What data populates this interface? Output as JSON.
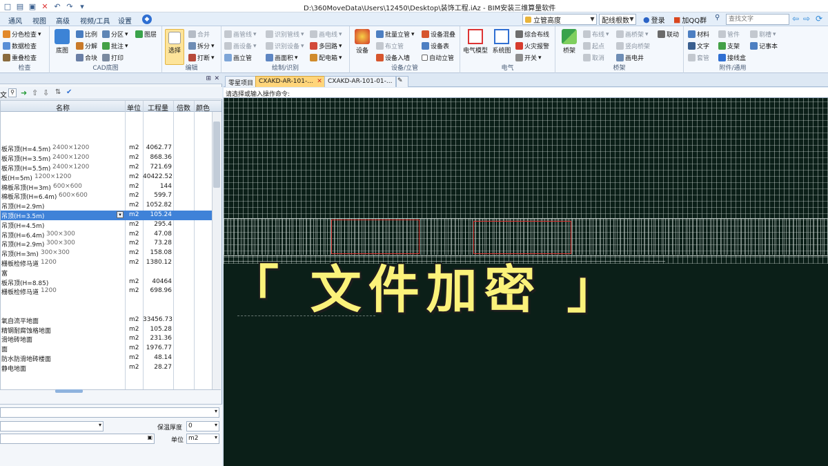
{
  "window": {
    "title": "D:\\360MoveData\\Users\\12450\\Desktop\\装饰工程.iAz - BIM安装三维算量软件"
  },
  "menu_tabs": [
    "通风",
    "视图",
    "高级",
    "视频/工具",
    "设置"
  ],
  "top_right": {
    "view_combo": "立管高度",
    "config_combo": "配线根数",
    "login": "登录",
    "qq_group": "加QQ群",
    "search_placeholder": "查找文字"
  },
  "ribbon": {
    "check": {
      "items": [
        "分色检查",
        "数据检查",
        "重叠检查"
      ],
      "label": "检查"
    },
    "cad": {
      "big": "底图",
      "items": [
        "比例",
        "分区",
        "图层",
        "分解",
        "批注",
        "合块",
        "打印"
      ],
      "label": "CAD底图"
    },
    "edit": {
      "big": "选择",
      "items": [
        "合并",
        "拆分",
        "打断"
      ],
      "label": "编辑"
    },
    "draw": {
      "items": [
        "画管线",
        "识别管线",
        "画电线",
        "画设备",
        "识别设备",
        "多回路",
        "画立管",
        "画面积",
        "配电箱"
      ],
      "label": "绘制/识别"
    },
    "equip": {
      "big": "设备",
      "items": [
        "批量立管",
        "设备混叠",
        "布立管",
        "设备表",
        "设备入墙",
        "自动立管"
      ],
      "label": "设备/立管"
    },
    "electric": {
      "bigs": [
        "电气模型",
        "系统图"
      ],
      "items": [
        "综合布线",
        "火灾报警",
        "开关"
      ],
      "label": "电气"
    },
    "bridge": {
      "big": "桥架",
      "items": [
        "布线",
        "画桥架",
        "联动",
        "起点",
        "竖向桥架",
        "取消",
        "画电井"
      ],
      "label": "桥架"
    },
    "attach": {
      "items": [
        "材料",
        "管件",
        "剔槽",
        "文字",
        "支架",
        "记事本",
        "套管",
        "接线盒"
      ],
      "label": "附件/通用"
    }
  },
  "left_panel": {
    "search_prefix": "文",
    "columns": [
      "名称",
      "单位",
      "工程量",
      "倍数",
      "颜色"
    ],
    "rows": [
      {
        "name": "",
        "spec": "",
        "unit": "",
        "qty": ""
      },
      {
        "name": "",
        "spec": "",
        "unit": "",
        "qty": ""
      },
      {
        "name": "",
        "spec": "",
        "unit": "",
        "qty": ""
      },
      {
        "name": "板吊顶(H=4.5m)",
        "spec": "2400×1200",
        "unit": "m2",
        "qty": "4062.77"
      },
      {
        "name": "板吊顶(H=3.5m)",
        "spec": "2400×1200",
        "unit": "m2",
        "qty": "868.36"
      },
      {
        "name": "板吊顶(H=5.5m)",
        "spec": "2400×1200",
        "unit": "m2",
        "qty": "721.69"
      },
      {
        "name": "板(H=5m)",
        "spec": "1200×1200",
        "unit": "m2",
        "qty": "40422.52"
      },
      {
        "name": "棉板吊顶(H=3m)",
        "spec": "600×600",
        "unit": "m2",
        "qty": "144"
      },
      {
        "name": "棉板吊顶(H=6.4m)",
        "spec": "600×600",
        "unit": "m2",
        "qty": "599.7"
      },
      {
        "name": "吊顶(H=2.9m)",
        "spec": "",
        "unit": "m2",
        "qty": "1052.82"
      },
      {
        "name": "吊顶(H=3.5m)",
        "spec": "",
        "unit": "m2",
        "qty": "105.24",
        "selected": true
      },
      {
        "name": "吊顶(H=4.5m)",
        "spec": "",
        "unit": "m2",
        "qty": "295.4"
      },
      {
        "name": "吊顶(H=6.4m)",
        "spec": "300×300",
        "unit": "m2",
        "qty": "47.08"
      },
      {
        "name": "吊顶(H=2.9m)",
        "spec": "300×300",
        "unit": "m2",
        "qty": "73.28"
      },
      {
        "name": "吊顶(H=3m)",
        "spec": "300×300",
        "unit": "m2",
        "qty": "158.08"
      },
      {
        "name": "栅板检修马道",
        "spec": "1200",
        "unit": "m2",
        "qty": "1380.12"
      },
      {
        "name": "富",
        "spec": "",
        "unit": "",
        "qty": ""
      },
      {
        "name": "板吊顶(H=8.85)",
        "spec": "",
        "unit": "m2",
        "qty": "40464"
      },
      {
        "name": "栅板检修马道",
        "spec": "1200",
        "unit": "m2",
        "qty": "698.96"
      },
      {
        "name": "",
        "spec": "",
        "unit": "",
        "qty": ""
      },
      {
        "name": "",
        "spec": "",
        "unit": "",
        "qty": ""
      },
      {
        "name": "氧自流平地面",
        "spec": "",
        "unit": "m2",
        "qty": "33456.73"
      },
      {
        "name": "精钢耐腐蚀格地面",
        "spec": "",
        "unit": "m2",
        "qty": "105.28"
      },
      {
        "name": "滑地砖地面",
        "spec": "",
        "unit": "m2",
        "qty": "231.36"
      },
      {
        "name": "面",
        "spec": "",
        "unit": "m2",
        "qty": "1976.77"
      },
      {
        "name": "防水防滑地砖楼面",
        "spec": "",
        "unit": "m2",
        "qty": "48.14"
      },
      {
        "name": "静电地面",
        "spec": "",
        "unit": "m2",
        "qty": "28.27"
      }
    ]
  },
  "properties": {
    "insulation_label": "保温厚度",
    "insulation_value": "0",
    "unit_label": "单位",
    "unit_value": "m2"
  },
  "doc_tabs": [
    "零星项目",
    "CXAKD-AR-101-...",
    "CXAKD-AR-101-01-..."
  ],
  "command_prompt": "请选择或输入操作命令:",
  "overlay_text": "「 文件加密 」",
  "colors": {
    "accent": "#ffd57a",
    "selection": "#3f82d8",
    "overlay": "#fbf27a",
    "cad_bg": "#0b1f18"
  }
}
